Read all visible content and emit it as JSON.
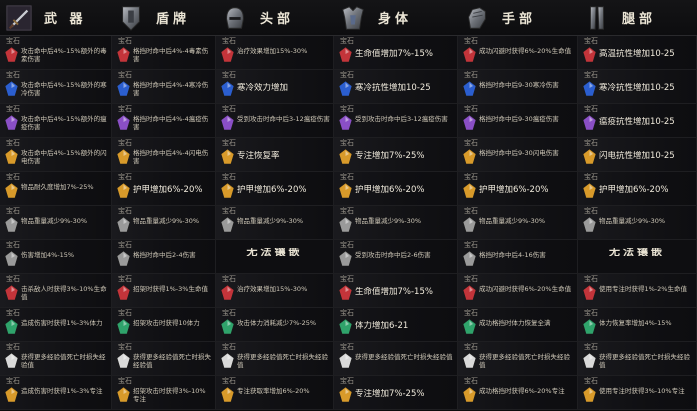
{
  "headers": [
    {
      "label": "武 器",
      "icon": "sword-icon"
    },
    {
      "label": "盾牌",
      "icon": "shield-icon"
    },
    {
      "label": "头部",
      "icon": "helmet-icon"
    },
    {
      "label": "身体",
      "icon": "chestplate-icon"
    },
    {
      "label": "手部",
      "icon": "gauntlet-icon"
    },
    {
      "label": "腿部",
      "icon": "greaves-icon"
    }
  ],
  "gem_tag": "宝石",
  "gem_colors": {
    "red": "#c3343a",
    "blue": "#2b5ecf",
    "purple": "#8a4fc6",
    "yellow": "#d89a2a",
    "grey": "#9a9a9a",
    "green": "#2fa36b",
    "white": "#d9d9d9"
  },
  "rows": [
    [
      {
        "gem": "red",
        "text": "攻击命中后4%-15%额外的毒素伤害",
        "big": false
      },
      {
        "gem": "red",
        "text": "格挡时命中后4%-4毒素伤害",
        "big": false
      },
      {
        "gem": "red",
        "text": "治疗效果增加15%-30%",
        "big": false
      },
      {
        "gem": "red",
        "text": "生命值增加7%-15%",
        "big": true
      },
      {
        "gem": "red",
        "text": "成功闪避时获得6%-20%生命值",
        "big": false
      },
      {
        "gem": "red",
        "text": "高温抗性增加10-25",
        "big": true
      }
    ],
    [
      {
        "gem": "blue",
        "text": "攻击命中后4%-15%额外的寒冷伤害",
        "big": false
      },
      {
        "gem": "blue",
        "text": "格挡时命中后4%-4寒冷伤害",
        "big": false
      },
      {
        "gem": "blue",
        "text": "寒冷效力增加",
        "big": true
      },
      {
        "gem": "blue",
        "text": "寒冷抗性增加10-25",
        "big": true
      },
      {
        "gem": "blue",
        "text": "格挡时命中后9-30寒冷伤害",
        "big": false
      },
      {
        "gem": "blue",
        "text": "寒冷抗性增加10-25",
        "big": true
      }
    ],
    [
      {
        "gem": "purple",
        "text": "攻击命中后4%-15%额外的瘟疫伤害",
        "big": false
      },
      {
        "gem": "purple",
        "text": "格挡时命中后4%-4瘟疫伤害",
        "big": false
      },
      {
        "gem": "purple",
        "text": "受到攻击时命中后3-12瘟疫伤害",
        "big": false
      },
      {
        "gem": "purple",
        "text": "受到攻击时命中后3-12瘟疫伤害",
        "big": false
      },
      {
        "gem": "purple",
        "text": "格挡时命中后9-30瘟疫伤害",
        "big": false
      },
      {
        "gem": "purple",
        "text": "瘟疫抗性增加10-25",
        "big": true
      }
    ],
    [
      {
        "gem": "yellow",
        "text": "攻击命中后4%-15%额外的闪电伤害",
        "big": false
      },
      {
        "gem": "yellow",
        "text": "格挡时命中后4%-4闪电伤害",
        "big": false
      },
      {
        "gem": "yellow",
        "text": "专注恢复率",
        "big": true
      },
      {
        "gem": "yellow",
        "text": "专注增加7%-25%",
        "big": true
      },
      {
        "gem": "yellow",
        "text": "格挡时命中后9-30闪电伤害",
        "big": false
      },
      {
        "gem": "yellow",
        "text": "闪电抗性增加10-25",
        "big": true
      }
    ],
    [
      {
        "gem": "yellow",
        "text": "物品耐久度增加7%-25%",
        "big": false
      },
      {
        "gem": "yellow",
        "text": "护甲增加6%-20%",
        "big": true
      },
      {
        "gem": "yellow",
        "text": "护甲增加6%-20%",
        "big": true
      },
      {
        "gem": "yellow",
        "text": "护甲增加6%-20%",
        "big": true
      },
      {
        "gem": "yellow",
        "text": "护甲增加6%-20%",
        "big": true
      },
      {
        "gem": "yellow",
        "text": "护甲增加6%-20%",
        "big": true
      }
    ],
    [
      {
        "gem": "grey",
        "text": "物品重量减少9%-30%",
        "big": false
      },
      {
        "gem": "grey",
        "text": "物品重量减少9%-30%",
        "big": false
      },
      {
        "gem": "grey",
        "text": "物品重量减少9%-30%",
        "big": false
      },
      {
        "gem": "grey",
        "text": "物品重量减少9%-30%",
        "big": false
      },
      {
        "gem": "grey",
        "text": "物品重量减少9%-30%",
        "big": false
      },
      {
        "gem": "grey",
        "text": "物品重量减少9%-30%",
        "big": false
      }
    ],
    [
      {
        "gem": "grey",
        "text": "伤害增加4%-15%",
        "big": false
      },
      {
        "gem": "grey",
        "text": "格挡时命中后2-4伤害",
        "big": false
      },
      {
        "gem": null,
        "text": "无法镶嵌",
        "big": false,
        "center": true
      },
      {
        "gem": "grey",
        "text": "受到攻击时命中后2-6伤害",
        "big": false
      },
      {
        "gem": "grey",
        "text": "格挡时命中后4-16伤害",
        "big": false
      },
      {
        "gem": null,
        "text": "无法镶嵌",
        "big": false,
        "center": true
      }
    ],
    [
      {
        "gem": "red",
        "text": "击杀敌人时获得3%-10%生命值",
        "big": false
      },
      {
        "gem": "red",
        "text": "招架时获得1%-3%生命值",
        "big": false
      },
      {
        "gem": "red",
        "text": "治疗效果增加15%-30%",
        "big": false
      },
      {
        "gem": "red",
        "text": "生命值增加7%-15%",
        "big": true
      },
      {
        "gem": "red",
        "text": "成功闪避时获得6%-20%生命值",
        "big": false
      },
      {
        "gem": "red",
        "text": "使用专注时获得1%-2%生命值",
        "big": false
      }
    ],
    [
      {
        "gem": "green",
        "text": "造成伤害时获得1%-3%体力",
        "big": false
      },
      {
        "gem": "green",
        "text": "招架攻击时获得10体力",
        "big": false
      },
      {
        "gem": "green",
        "text": "攻击体力消耗减少7%-25%",
        "big": false
      },
      {
        "gem": "green",
        "text": "体力增加6-21",
        "big": true
      },
      {
        "gem": "green",
        "text": "成功格挡时体力恢复全满",
        "big": false
      },
      {
        "gem": "green",
        "text": "体力恢复率增加4%-15%",
        "big": false
      }
    ],
    [
      {
        "gem": "white",
        "text": "获得更多经验值死亡时损失经验值",
        "big": false
      },
      {
        "gem": "white",
        "text": "获得更多经验值死亡时损失经验值",
        "big": false
      },
      {
        "gem": "white",
        "text": "获得更多经验值死亡时损失经验值",
        "big": false
      },
      {
        "gem": "white",
        "text": "获得更多经验值死亡时损失经验值",
        "big": false
      },
      {
        "gem": "white",
        "text": "获得更多经验值死亡时损失经验值",
        "big": false
      },
      {
        "gem": "white",
        "text": "获得更多经验值死亡时损失经验值",
        "big": false
      }
    ],
    [
      {
        "gem": "yellow",
        "text": "造成伤害时获得1%-3%专注",
        "big": false
      },
      {
        "gem": "yellow",
        "text": "招架攻击时获得3%-10%专注",
        "big": false
      },
      {
        "gem": "yellow",
        "text": "专注获取率增加6%-20%",
        "big": false
      },
      {
        "gem": "yellow",
        "text": "专注增加7%-25%",
        "big": true
      },
      {
        "gem": "yellow",
        "text": "成功格挡时获得6%-20%专注",
        "big": false
      },
      {
        "gem": "yellow",
        "text": "使用专注时获得3%-10%专注",
        "big": false
      }
    ]
  ]
}
